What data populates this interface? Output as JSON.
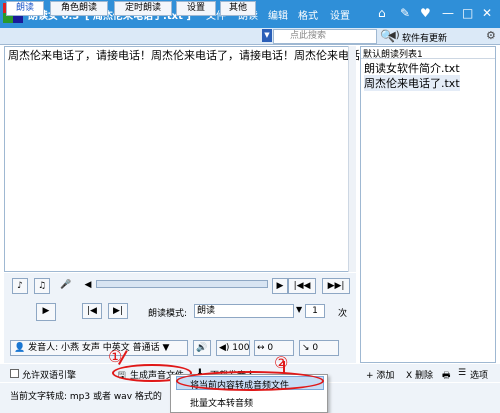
{
  "app": {
    "name": "朗读女 6.3",
    "file_title": "[ 周杰伦来电话了.txt ]"
  },
  "menu": [
    "文件",
    "朗读",
    "编辑",
    "格式",
    "设置"
  ],
  "tabs": [
    "朗读",
    "角色朗读",
    "定时朗读",
    "设置",
    "其他"
  ],
  "search": {
    "placeholder": "点此搜索"
  },
  "update_label": "软件有更新",
  "editor": {
    "text": "周杰伦来电话了，请接电话！周杰伦来电话了，请接电话！周杰伦来电话了，请接电话！"
  },
  "playlist": {
    "header": "默认朗读列表1",
    "items": [
      "朗读女软件简介.txt",
      "周杰伦来电话了.txt"
    ]
  },
  "controls": {
    "mode_label": "朗读模式:",
    "mode_value": "朗读",
    "repeat_value": "1",
    "repeat_unit": "次",
    "progress": 0
  },
  "speaker": {
    "label": "发音人: 小燕 女声 中英文 普通话",
    "volume": "100",
    "speed": "0",
    "pitch": "0"
  },
  "bottom": {
    "bilingual": "允许双语引擎",
    "generate_audio": "生成声音文件",
    "download_voice": "下载发音人",
    "add": "+ 添加",
    "delete": "X 删除",
    "options": "选项",
    "status": "当前文字转成: mp3 或者 wav 格式的"
  },
  "context_menu": {
    "items": [
      "将当前内容转成音频文件",
      "批量文本转音频"
    ]
  },
  "annotations": [
    "①",
    "②"
  ]
}
